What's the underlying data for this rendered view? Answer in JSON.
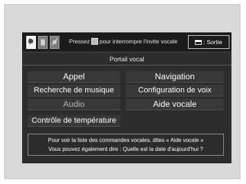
{
  "topbar": {
    "hint_prefix": "Pressez",
    "hint_suffix": "pour interrompre l'invite vocale",
    "exit_label": ": Sortie"
  },
  "screen": {
    "title": "Portail vocal"
  },
  "commands": {
    "appel": "Appel",
    "navigation": "Navigation",
    "musique": "Recherche de musique",
    "voix": "Configuration de voix",
    "audio": "Audio",
    "aide": "Aide vocale",
    "temperature": "Contrôle de température"
  },
  "footer": {
    "line1": "Pour voir la liste des commandes vocales, dites « Aide vocale »",
    "line2": "Vous pouvez également dire : Quelle est la date d'aujourd'hui ?"
  },
  "icons": [
    "voice-prompt-icon",
    "phone-icon",
    "voice-mute-icon",
    "talk-button-icon",
    "back-icon"
  ]
}
